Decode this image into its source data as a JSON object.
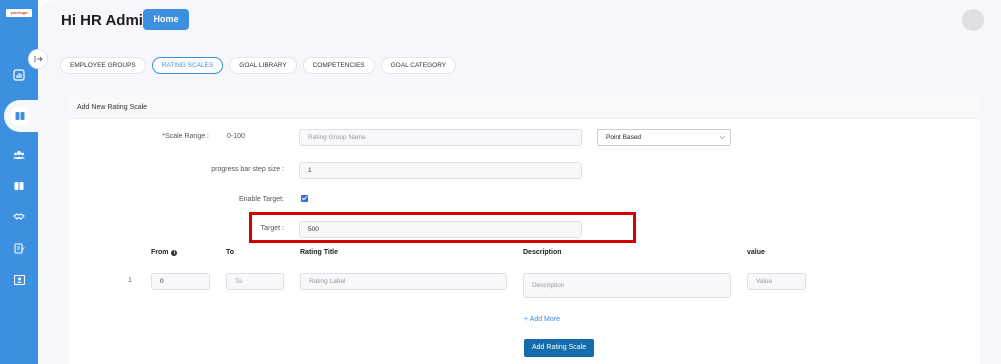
{
  "sidebar": {
    "logo_text": "yourlogo",
    "icons": [
      "chart-icon",
      "book-icon",
      "users-icon",
      "book-icon",
      "handshake-icon",
      "edit-icon",
      "id-card-icon"
    ],
    "accent": "#3d8fe0"
  },
  "header": {
    "greeting": "Hi HR Admin",
    "home_label": "Home"
  },
  "tabs": [
    {
      "label": "EMPLOYEE GROUPS",
      "active": false
    },
    {
      "label": "RATING SCALES",
      "active": true
    },
    {
      "label": "GOAL LIBRARY",
      "active": false
    },
    {
      "label": "COMPETENCIES",
      "active": false
    },
    {
      "label": "GOAL CATEGORY",
      "active": false
    }
  ],
  "form": {
    "panel_title": "Add New Rating Scale",
    "scale_range_label": "*Scale Range :",
    "scale_range_value": "0-100",
    "rating_group_placeholder": "Rating Group Name",
    "scale_type_value": "Point Based",
    "step_size_label": "progress bar step size :",
    "step_size_value": "1",
    "enable_target_label": "Enable Target:",
    "enable_target_checked": true,
    "target_label": "Target :",
    "target_value": "500"
  },
  "table": {
    "headers": {
      "from": "From",
      "to": "To",
      "title": "Rating Title",
      "description": "Description",
      "value": "value"
    },
    "rows": [
      {
        "num": "1",
        "from": "0",
        "to_placeholder": "To",
        "title_placeholder": "Rating Label",
        "description_placeholder": "Description",
        "value_placeholder": "Value"
      }
    ],
    "add_more_label": "+ Add More",
    "submit_label": "Add Rating Scale"
  }
}
